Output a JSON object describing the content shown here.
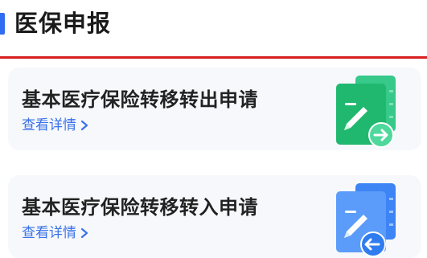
{
  "header": {
    "title": "医保申报"
  },
  "cards": [
    {
      "title": "基本医疗保险转移转出申请",
      "link_label": "查看详情",
      "icon": "document-transfer-out-icon",
      "accent_color": "#22c47a"
    },
    {
      "title": "基本医疗保险转移转入申请",
      "link_label": "查看详情",
      "icon": "document-transfer-in-icon",
      "accent_color": "#2f7cf0"
    }
  ],
  "colors": {
    "header_accent": "#2f6ef2",
    "header_rule": "#d81e1e",
    "link": "#3a72e8",
    "card_background": "#f6f8fc"
  }
}
